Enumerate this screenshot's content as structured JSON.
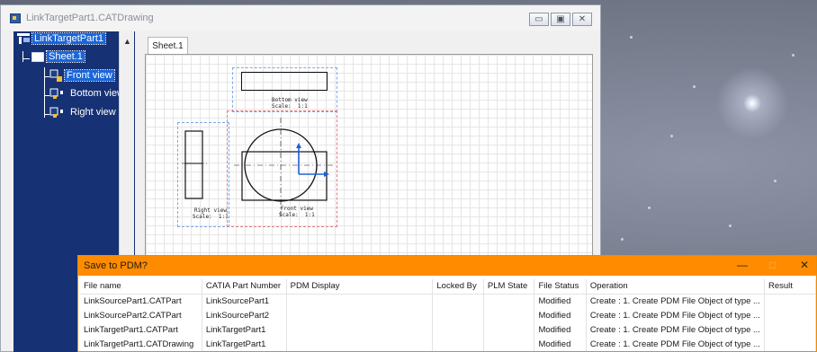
{
  "window": {
    "title": "LinkTargetPart1.CATDrawing",
    "controls": {
      "minimize": "▭",
      "restore": "▣",
      "close": "✕"
    }
  },
  "tree": {
    "root": "LinkTargetPart1",
    "sheet": "Sheet.1",
    "views": [
      "Front view",
      "Bottom view",
      "Right view"
    ]
  },
  "sheet_tab": "Sheet.1",
  "drawing": {
    "bottom_view_caption": "Bottom view\nScale:  1:1",
    "right_view_caption": "Right view\nScale:  1:1",
    "front_view_caption": "Front view\nScale:  1:1"
  },
  "dialog": {
    "title": "Save to PDM?",
    "controls": {
      "minimize": "—",
      "maximize": "□",
      "close": "✕"
    },
    "columns": [
      "File name",
      "CATIA Part Number",
      "PDM Display",
      "Locked By",
      "PLM State",
      "File Status",
      "Operation",
      "Result"
    ],
    "rows": [
      [
        "LinkSourcePart1.CATPart",
        "LinkSourcePart1",
        "",
        "",
        "",
        "Modified",
        "Create : 1. Create PDM File Object of type ...",
        ""
      ],
      [
        "LinkSourcePart2.CATPart",
        "LinkSourcePart2",
        "",
        "",
        "",
        "Modified",
        "Create : 1. Create PDM File Object of type ...",
        ""
      ],
      [
        "LinkTargetPart1.CATPart",
        "LinkTargetPart1",
        "",
        "",
        "",
        "Modified",
        "Create : 1. Create PDM File Object of type ...",
        ""
      ],
      [
        "LinkTargetPart1.CATDrawing",
        "LinkTargetPart1",
        "",
        "",
        "",
        "Modified",
        "Create : 1. Create PDM File Object of type ...",
        ""
      ]
    ]
  },
  "colors": {
    "tree_bg": "#163174",
    "dialog_accent": "#ff8c00",
    "selection": "#1a66d9"
  }
}
